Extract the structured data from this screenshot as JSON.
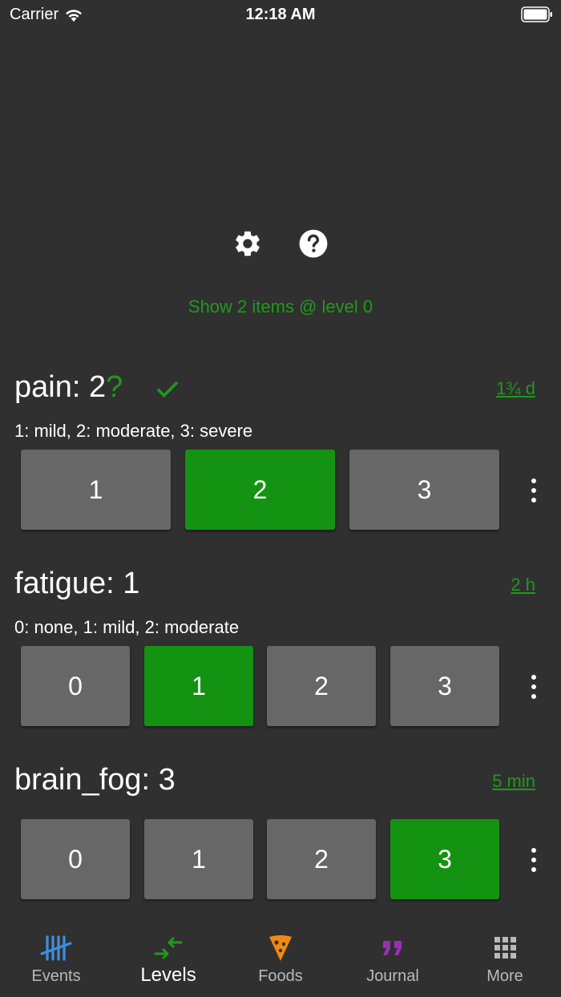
{
  "status_bar": {
    "carrier": "Carrier",
    "time": "12:18 AM"
  },
  "show_items_label": "Show 2 items @ level 0",
  "items": [
    {
      "name": "pain",
      "title": "pain: 2",
      "unsaved_mark": "?",
      "elapsed": "1¾ d",
      "description": "1: mild, 2: moderate, 3: severe",
      "levels": [
        "1",
        "2",
        "3"
      ],
      "selected": "2"
    },
    {
      "name": "fatigue",
      "title": "fatigue: 1",
      "elapsed": "2 h",
      "description": "0: none, 1: mild, 2: moderate",
      "levels": [
        "0",
        "1",
        "2",
        "3"
      ],
      "selected": "1"
    },
    {
      "name": "brain_fog",
      "title": "brain_fog: 3",
      "elapsed": "5 min",
      "description": "",
      "levels": [
        "0",
        "1",
        "2",
        "3"
      ],
      "selected": "3"
    }
  ],
  "tabs": [
    {
      "label": "Events",
      "icon": "tally-icon",
      "color": "#3d8fe0"
    },
    {
      "label": "Levels",
      "icon": "arrows-in-icon",
      "color": "#1f9a1a",
      "active": true
    },
    {
      "label": "Foods",
      "icon": "pizza-icon",
      "color": "#f08a12"
    },
    {
      "label": "Journal",
      "icon": "quote-icon",
      "color": "#9b2db3"
    },
    {
      "label": "More",
      "icon": "grid-icon",
      "color": "#b9b9b9"
    }
  ],
  "colors": {
    "background": "#303030",
    "accent_green": "#1f9a1a",
    "selected_button": "#149313",
    "button": "#676767"
  }
}
